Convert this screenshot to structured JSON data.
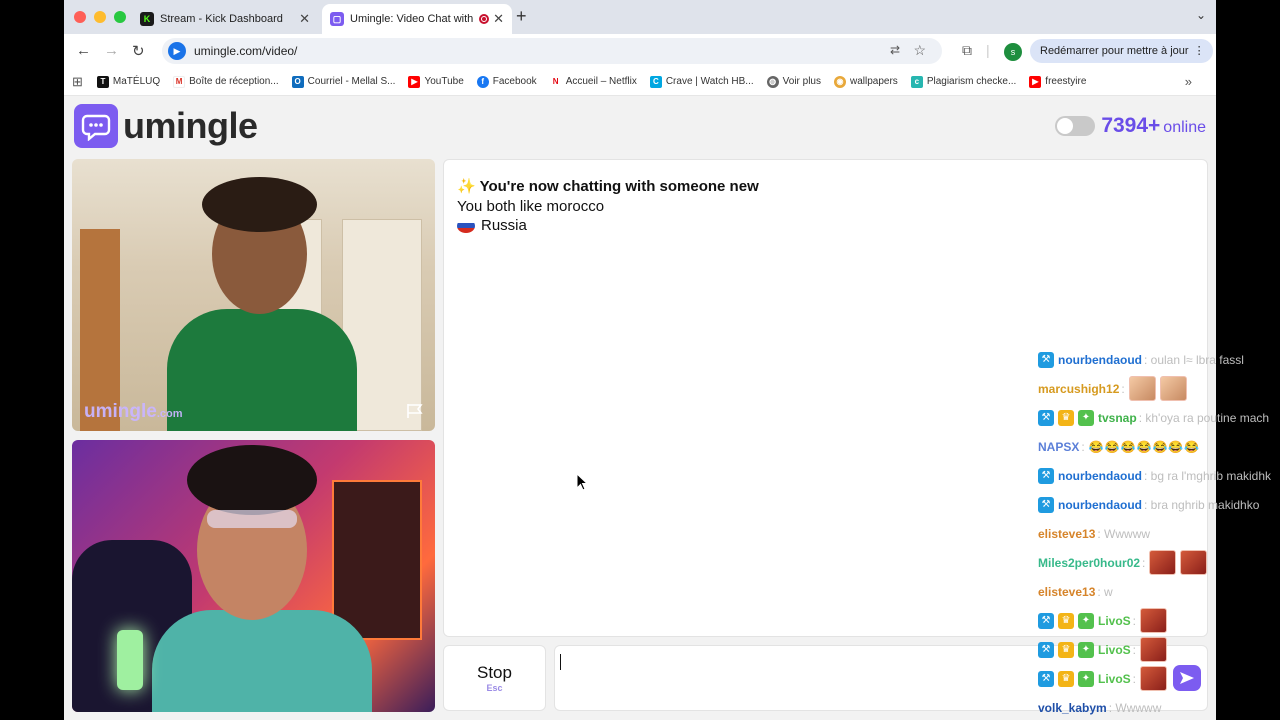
{
  "browser": {
    "tabs": [
      {
        "title": "Stream - Kick Dashboard",
        "icon": "kick-icon"
      },
      {
        "title": "Umingle: Video Chat with",
        "icon": "umingle-icon"
      }
    ],
    "url": "umingle.com/video/",
    "profile_initial": "s",
    "restart_label": "Redémarrer pour mettre à jour",
    "bookmarks": [
      "MaTÉLUQ",
      "Boîte de réception...",
      "Courriel - Mellal S...",
      "YouTube",
      "Facebook",
      "Accueil – Netflix",
      "Crave | Watch HB...",
      "Voir plus",
      "wallpapers",
      "Plagiarism checke...",
      "freestyire"
    ]
  },
  "site": {
    "logo_text": "umingle",
    "online_count": "7394+",
    "online_label": "online",
    "watermark_main": "umingle",
    "watermark_suffix": ".com"
  },
  "chat": {
    "line1": "You're now chatting with someone new",
    "line2": "You both like morocco",
    "country": "Russia"
  },
  "controls": {
    "stop_label": "Stop",
    "stop_key": "Esc"
  },
  "overlay_chat": [
    {
      "user": "nourbendaoud",
      "color": "#1f6fd1",
      "text": ": oulan l≈ lbra fassl",
      "badges": [
        "mod"
      ],
      "emotes": 0
    },
    {
      "user": "marcushigh12",
      "color": "#d69a1f",
      "text": ":",
      "badges": [],
      "emotes": 2,
      "emote_style": "face"
    },
    {
      "user": "tvsnap",
      "color": "#3fb24a",
      "text": ": kh'oya ra poutine mach",
      "badges": [
        "mod",
        "vip",
        "sub"
      ],
      "emotes": 0
    },
    {
      "user": "NAPSX",
      "color": "#5b7fd8",
      "text": ":",
      "badges": [],
      "emotes": 0,
      "laugh": "😂😂😂😂😂😂😂"
    },
    {
      "user": "nourbendaoud",
      "color": "#1f6fd1",
      "text": ": bg ra l'mghrib makidhk",
      "badges": [
        "mod"
      ],
      "emotes": 0
    },
    {
      "user": "nourbendaoud",
      "color": "#1f6fd1",
      "text": ": bra   nghrib makidhko",
      "badges": [
        "mod"
      ],
      "emotes": 0
    },
    {
      "user": "elisteve13",
      "color": "#d6842a",
      "text": ": Wwwww",
      "badges": [],
      "emotes": 0
    },
    {
      "user": "Miles2per0hour02",
      "color": "#37b98a",
      "text": ":",
      "badges": [],
      "emotes": 2
    },
    {
      "user": "elisteve13",
      "color": "#d6842a",
      "text": ": w",
      "badges": [],
      "emotes": 0
    },
    {
      "user": "LivoS",
      "color": "#53c14d",
      "text": ":",
      "badges": [
        "mod",
        "vip",
        "sub"
      ],
      "emotes": 1
    },
    {
      "user": "LivoS",
      "color": "#53c14d",
      "text": ":",
      "badges": [
        "mod",
        "vip",
        "sub"
      ],
      "emotes": 1
    },
    {
      "user": "LivoS",
      "color": "#53c14d",
      "text": ":",
      "badges": [
        "mod",
        "vip",
        "sub"
      ],
      "emotes": 1
    },
    {
      "user": "volk_kabym",
      "color": "#1f4fa8",
      "text": ": Wwwww",
      "badges": [],
      "emotes": 0
    }
  ]
}
